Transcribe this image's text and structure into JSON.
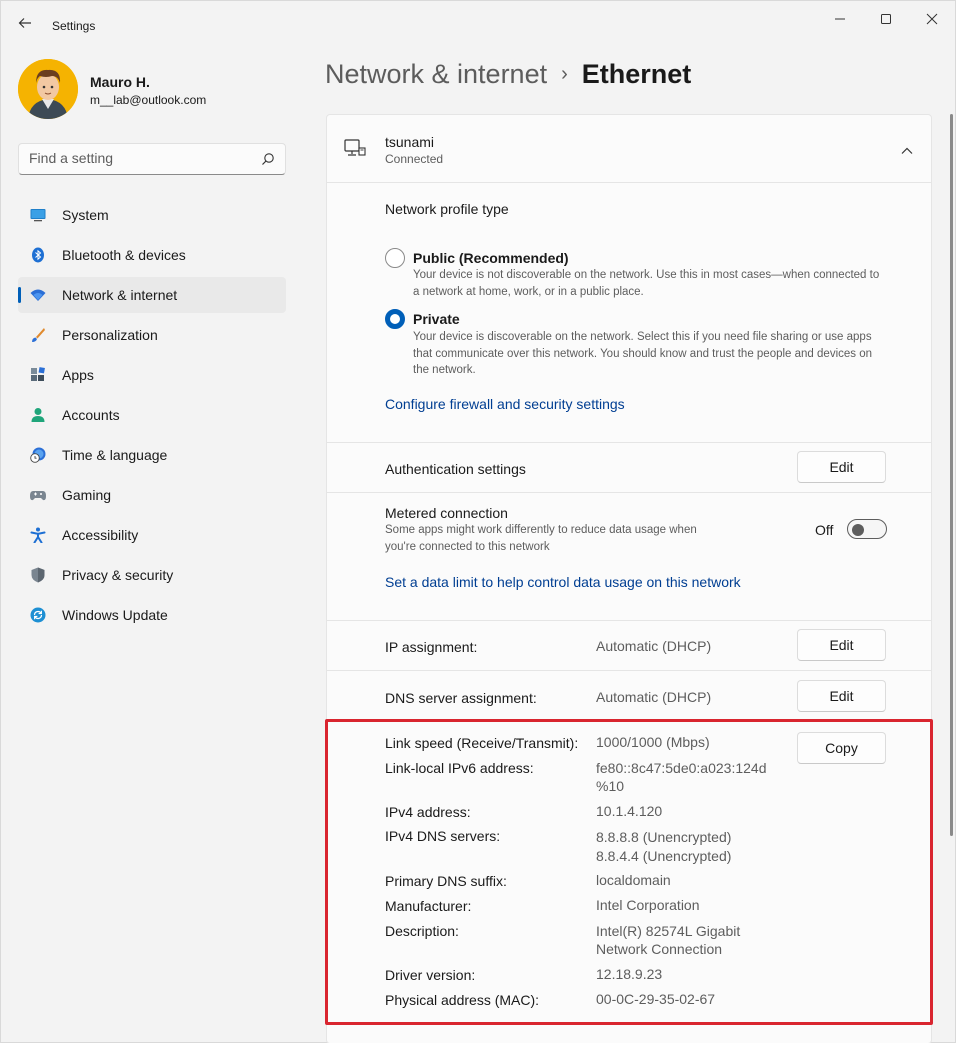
{
  "window": {
    "app_title": "Settings",
    "back_icon": "back-arrow-icon",
    "minimize_icon": "minimize-icon",
    "maximize_icon": "maximize-icon",
    "close_icon": "close-icon"
  },
  "profile": {
    "name": "Mauro H.",
    "email": "m__lab@outlook.com"
  },
  "search": {
    "placeholder": "Find a setting"
  },
  "sidebar": {
    "items": [
      {
        "label": "System",
        "icon": "system-icon"
      },
      {
        "label": "Bluetooth & devices",
        "icon": "bluetooth-icon"
      },
      {
        "label": "Network & internet",
        "icon": "wifi-icon",
        "active": true
      },
      {
        "label": "Personalization",
        "icon": "brush-icon"
      },
      {
        "label": "Apps",
        "icon": "apps-icon"
      },
      {
        "label": "Accounts",
        "icon": "person-icon"
      },
      {
        "label": "Time & language",
        "icon": "clock-globe-icon"
      },
      {
        "label": "Gaming",
        "icon": "gamepad-icon"
      },
      {
        "label": "Accessibility",
        "icon": "accessibility-icon"
      },
      {
        "label": "Privacy & security",
        "icon": "shield-icon"
      },
      {
        "label": "Windows Update",
        "icon": "update-icon"
      }
    ]
  },
  "header": {
    "parent": "Network & internet",
    "separator": "›",
    "current": "Ethernet"
  },
  "network": {
    "name": "tsunami",
    "status": "Connected"
  },
  "profile_type": {
    "title": "Network profile type",
    "options": [
      {
        "title": "Public (Recommended)",
        "description": "Your device is not discoverable on the network. Use this in most cases—when connected to a network at home, work, or in a public place.",
        "selected": false
      },
      {
        "title": "Private",
        "description": "Your device is discoverable on the network. Select this if you need file sharing or use apps that communicate over this network. You should know and trust the people and devices on the network.",
        "selected": true
      }
    ],
    "firewall_link": "Configure firewall and security settings"
  },
  "authentication": {
    "label": "Authentication settings",
    "button": "Edit"
  },
  "metered": {
    "title": "Metered connection",
    "description": "Some apps might work differently to reduce data usage when you're connected to this network",
    "state_label": "Off",
    "on": false,
    "data_limit_link": "Set a data limit to help control data usage on this network"
  },
  "ip_assignment": {
    "label": "IP assignment:",
    "value": "Automatic (DHCP)",
    "button": "Edit"
  },
  "dns_assignment": {
    "label": "DNS server assignment:",
    "value": "Automatic (DHCP)",
    "button": "Edit"
  },
  "properties": {
    "copy_button": "Copy",
    "link_speed": {
      "label": "Link speed (Receive/Transmit):",
      "value": "1000/1000 (Mbps)"
    },
    "ipv6": {
      "label": "Link-local IPv6 address:",
      "value_line1": "fe80::8c47:5de0:a023:124d",
      "value_line2": "%10"
    },
    "ipv4": {
      "label": "IPv4 address:",
      "value": "10.1.4.120"
    },
    "dns_servers": {
      "label": "IPv4 DNS servers:",
      "value_line1": "8.8.8.8 (Unencrypted)",
      "value_line2": "8.8.4.4 (Unencrypted)"
    },
    "dns_suffix": {
      "label": "Primary DNS suffix:",
      "value": "localdomain"
    },
    "manufacturer": {
      "label": "Manufacturer:",
      "value": "Intel Corporation"
    },
    "description": {
      "label": "Description:",
      "value_line1": "Intel(R) 82574L Gigabit",
      "value_line2": "Network Connection"
    },
    "driver": {
      "label": "Driver version:",
      "value": "12.18.9.23"
    },
    "mac": {
      "label": "Physical address (MAC):",
      "value": "00-0C-29-35-02-67"
    }
  },
  "colors": {
    "accent": "#005fb8",
    "link": "#003e92",
    "highlight_border": "#d9252f",
    "background": "#f3f3f3"
  }
}
